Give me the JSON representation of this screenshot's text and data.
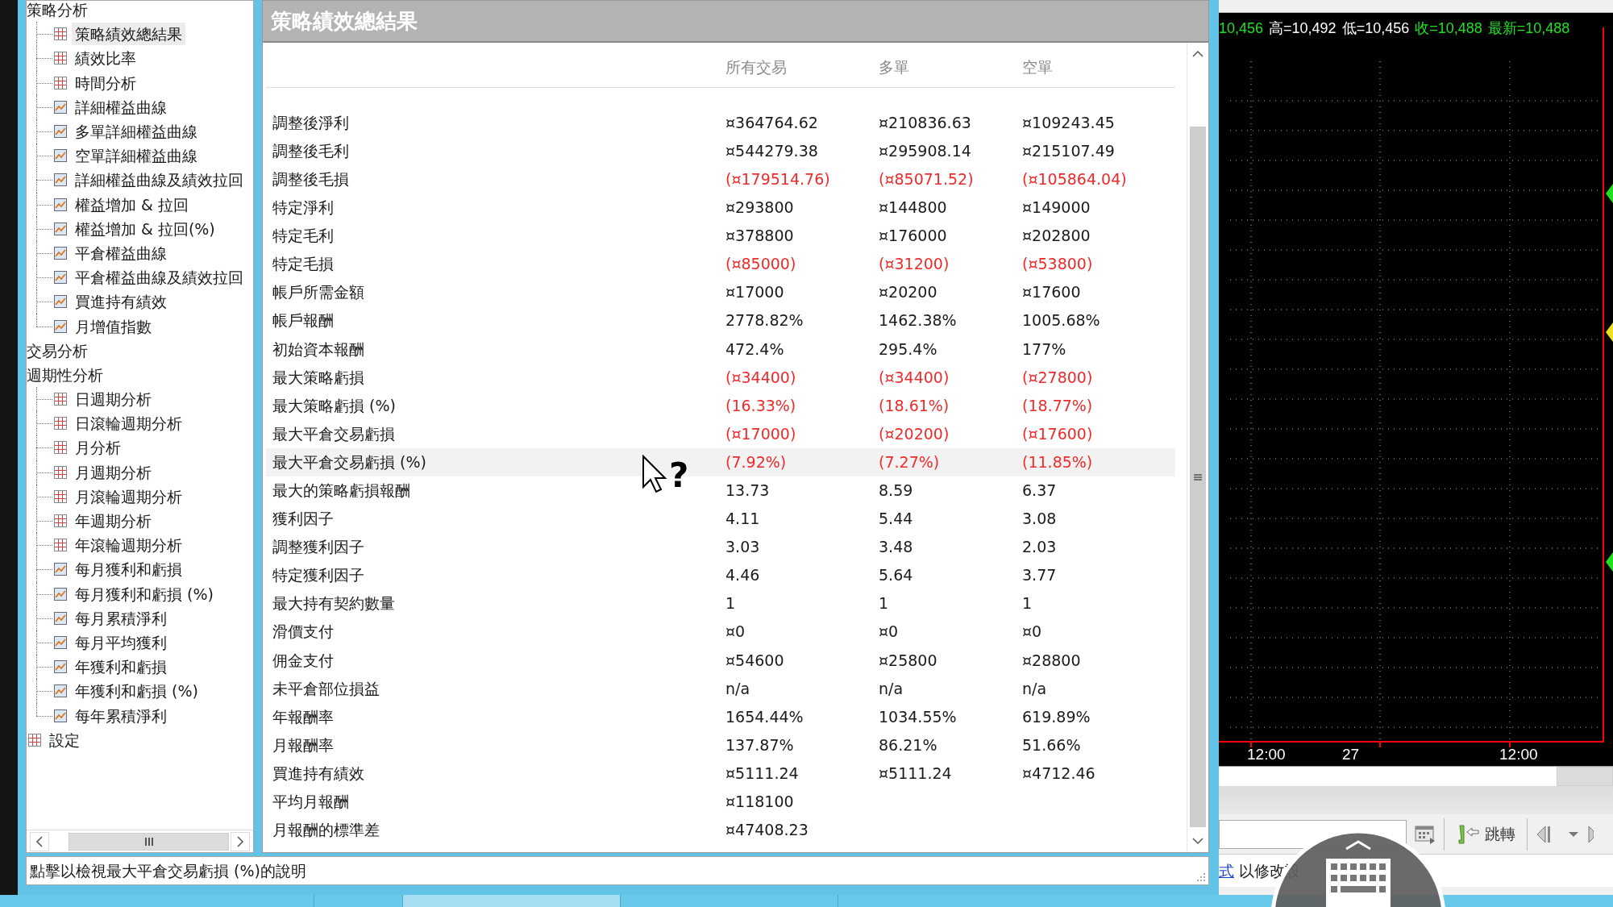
{
  "tree": [
    {
      "label": "策略分析",
      "selected": false,
      "children": [
        {
          "label": "策略績效總結果",
          "kind": "grid",
          "selected": true
        },
        {
          "label": "績效比率",
          "kind": "grid",
          "selected": false
        },
        {
          "label": "時間分析",
          "kind": "grid",
          "selected": false
        },
        {
          "label": "詳細權益曲線",
          "kind": "chart",
          "selected": false
        },
        {
          "label": "多單詳細權益曲線",
          "kind": "chart",
          "selected": false
        },
        {
          "label": "空單詳細權益曲線",
          "kind": "chart",
          "selected": false
        },
        {
          "label": "詳細權益曲線及績效拉回",
          "kind": "chart",
          "selected": false
        },
        {
          "label": "權益增加 & 拉回",
          "kind": "chart",
          "selected": false
        },
        {
          "label": "權益增加 & 拉回(%)",
          "kind": "chart",
          "selected": false
        },
        {
          "label": "平倉權益曲線",
          "kind": "chart",
          "selected": false
        },
        {
          "label": "平倉權益曲線及績效拉回",
          "kind": "chart",
          "selected": false
        },
        {
          "label": "買進持有績效",
          "kind": "chart",
          "selected": false
        },
        {
          "label": "月增值指數",
          "kind": "chart",
          "selected": false
        }
      ]
    },
    {
      "label": "交易分析",
      "selected": false
    },
    {
      "label": "週期性分析",
      "selected": false,
      "children": [
        {
          "label": "日週期分析",
          "kind": "grid",
          "selected": false
        },
        {
          "label": "日滾輪週期分析",
          "kind": "grid",
          "selected": false
        },
        {
          "label": "月分析",
          "kind": "grid",
          "selected": false
        },
        {
          "label": "月週期分析",
          "kind": "grid",
          "selected": false
        },
        {
          "label": "月滾輪週期分析",
          "kind": "grid",
          "selected": false
        },
        {
          "label": "年週期分析",
          "kind": "grid",
          "selected": false
        },
        {
          "label": "年滾輪週期分析",
          "kind": "grid",
          "selected": false
        },
        {
          "label": "每月獲利和虧損",
          "kind": "chart",
          "selected": false
        },
        {
          "label": "每月獲利和虧損 (%)",
          "kind": "chart",
          "selected": false
        },
        {
          "label": "每月累積淨利",
          "kind": "chart",
          "selected": false
        },
        {
          "label": "每月平均獲利",
          "kind": "chart",
          "selected": false
        },
        {
          "label": "年獲利和虧損",
          "kind": "chart",
          "selected": false
        },
        {
          "label": "年獲利和虧損 (%)",
          "kind": "chart",
          "selected": false
        },
        {
          "label": "每年累積淨利",
          "kind": "chart",
          "selected": false
        }
      ]
    },
    {
      "label": "設定",
      "kind": "grid",
      "selected": false
    }
  ],
  "status_text": "點擊以檢視最大平倉交易虧損 (%)的說明",
  "panel": {
    "title": "策略績效總結果",
    "columns": [
      "所有交易",
      "多單",
      "空單"
    ],
    "rows": [
      {
        "label": "調整後淨利",
        "values": [
          "¤364764.62",
          "¤210836.63",
          "¤109243.45"
        ],
        "negative": false,
        "selected": false
      },
      {
        "label": "調整後毛利",
        "values": [
          "¤544279.38",
          "¤295908.14",
          "¤215107.49"
        ],
        "negative": false,
        "selected": false
      },
      {
        "label": "調整後毛損",
        "values": [
          "(¤179514.76)",
          "(¤85071.52)",
          "(¤105864.04)"
        ],
        "negative": true,
        "selected": false
      },
      {
        "label": "特定淨利",
        "values": [
          "¤293800",
          "¤144800",
          "¤149000"
        ],
        "negative": false,
        "selected": false
      },
      {
        "label": "特定毛利",
        "values": [
          "¤378800",
          "¤176000",
          "¤202800"
        ],
        "negative": false,
        "selected": false
      },
      {
        "label": "特定毛損",
        "values": [
          "(¤85000)",
          "(¤31200)",
          "(¤53800)"
        ],
        "negative": true,
        "selected": false
      },
      {
        "label": "帳戶所需金額",
        "values": [
          "¤17000",
          "¤20200",
          "¤17600"
        ],
        "negative": false,
        "selected": false
      },
      {
        "label": "帳戶報酬",
        "values": [
          "2778.82%",
          "1462.38%",
          "1005.68%"
        ],
        "negative": false,
        "selected": false
      },
      {
        "label": "初始資本報酬",
        "values": [
          "472.4%",
          "295.4%",
          "177%"
        ],
        "negative": false,
        "selected": false
      },
      {
        "label": "最大策略虧損",
        "values": [
          "(¤34400)",
          "(¤34400)",
          "(¤27800)"
        ],
        "negative": true,
        "selected": false
      },
      {
        "label": "最大策略虧損 (%)",
        "values": [
          "(16.33%)",
          "(18.61%)",
          "(18.77%)"
        ],
        "negative": true,
        "selected": false
      },
      {
        "label": "最大平倉交易虧損",
        "values": [
          "(¤17000)",
          "(¤20200)",
          "(¤17600)"
        ],
        "negative": true,
        "selected": false
      },
      {
        "label": "最大平倉交易虧損 (%)",
        "values": [
          "(7.92%)",
          "(7.27%)",
          "(11.85%)"
        ],
        "negative": true,
        "selected": true
      },
      {
        "label": "最大的策略虧損報酬",
        "values": [
          "13.73",
          "8.59",
          "6.37"
        ],
        "negative": false,
        "selected": false
      },
      {
        "label": "獲利因子",
        "values": [
          "4.11",
          "5.44",
          "3.08"
        ],
        "negative": false,
        "selected": false
      },
      {
        "label": "調整獲利因子",
        "values": [
          "3.03",
          "3.48",
          "2.03"
        ],
        "negative": false,
        "selected": false
      },
      {
        "label": "特定獲利因子",
        "values": [
          "4.46",
          "5.64",
          "3.77"
        ],
        "negative": false,
        "selected": false
      },
      {
        "label": "最大持有契約數量",
        "values": [
          "1",
          "1",
          "1"
        ],
        "negative": false,
        "selected": false
      },
      {
        "label": "滑價支付",
        "values": [
          "¤0",
          "¤0",
          "¤0"
        ],
        "negative": false,
        "selected": false
      },
      {
        "label": "佣金支付",
        "values": [
          "¤54600",
          "¤25800",
          "¤28800"
        ],
        "negative": false,
        "selected": false
      },
      {
        "label": "未平倉部位損益",
        "values": [
          "n/a",
          "n/a",
          "n/a"
        ],
        "negative": false,
        "selected": false
      },
      {
        "label": "年報酬率",
        "values": [
          "1654.44%",
          "1034.55%",
          "619.89%"
        ],
        "negative": false,
        "selected": false
      },
      {
        "label": "月報酬率",
        "values": [
          "137.87%",
          "86.21%",
          "51.66%"
        ],
        "negative": false,
        "selected": false
      },
      {
        "label": "買進持有績效",
        "values": [
          "¤5111.24",
          "¤5111.24",
          "¤4712.46"
        ],
        "negative": false,
        "selected": false
      },
      {
        "label": "平均月報酬",
        "values": [
          "¤118100"
        ],
        "negative": false,
        "selected": false
      },
      {
        "label": "月報酬的標準差",
        "values": [
          "¤47408.23"
        ],
        "negative": false,
        "selected": false
      }
    ]
  },
  "help_cursor": {
    "glyph": "?"
  },
  "chart": {
    "quote": [
      {
        "text": "10,456",
        "color": "#20e020"
      },
      {
        "text": "高=10,492",
        "color": "#ffffff"
      },
      {
        "text": "低=10,456",
        "color": "#ffffff"
      },
      {
        "text": "收=10,488",
        "color": "#20e020"
      },
      {
        "text": "最新=10,488",
        "color": "#20e020"
      }
    ],
    "time_labels": [
      "12:00",
      "27",
      "12:00"
    ]
  },
  "toolbar": {
    "jump_button": "跳轉"
  },
  "chart_status": {
    "link": "式",
    "text": "以修改設"
  }
}
